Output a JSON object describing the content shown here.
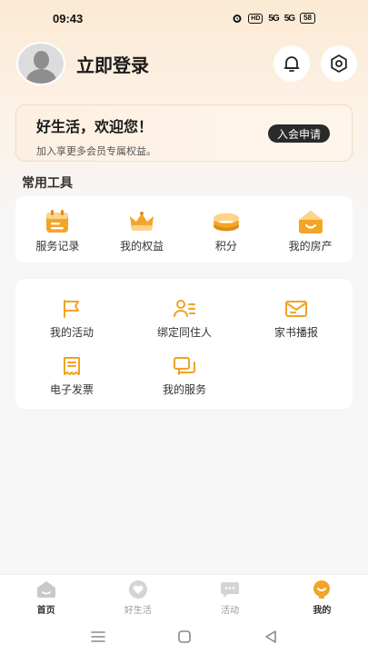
{
  "status_bar": {
    "time": "09:43",
    "hd": "HD",
    "signal1": "5G",
    "signal2": "5G",
    "battery": "58"
  },
  "profile": {
    "login_label": "立即登录"
  },
  "welcome": {
    "title": "好生活，欢迎您！",
    "subtitle": "加入享更多会员专属权益。",
    "apply_label": "入会申请"
  },
  "section_title": "常用工具",
  "tools": [
    {
      "label": "服务记录",
      "icon": "calendar-icon"
    },
    {
      "label": "我的权益",
      "icon": "crown-icon"
    },
    {
      "label": "积分",
      "icon": "coins-icon"
    },
    {
      "label": "我的房产",
      "icon": "house-icon"
    }
  ],
  "services": [
    {
      "label": "我的活动",
      "icon": "flag-icon"
    },
    {
      "label": "绑定同住人",
      "icon": "user-list-icon"
    },
    {
      "label": "家书播报",
      "icon": "mail-icon"
    },
    {
      "label": "电子发票",
      "icon": "invoice-icon"
    },
    {
      "label": "我的服务",
      "icon": "chat-windows-icon"
    }
  ],
  "tabs": [
    {
      "label": "首页",
      "icon": "home-icon"
    },
    {
      "label": "好生活",
      "icon": "heart-icon"
    },
    {
      "label": "活动",
      "icon": "chat-icon"
    },
    {
      "label": "我的",
      "icon": "profile-icon"
    }
  ],
  "colors": {
    "accent": "#f0a324",
    "accent_light": "#ffd28a",
    "dark_button": "#2a2a2a"
  }
}
